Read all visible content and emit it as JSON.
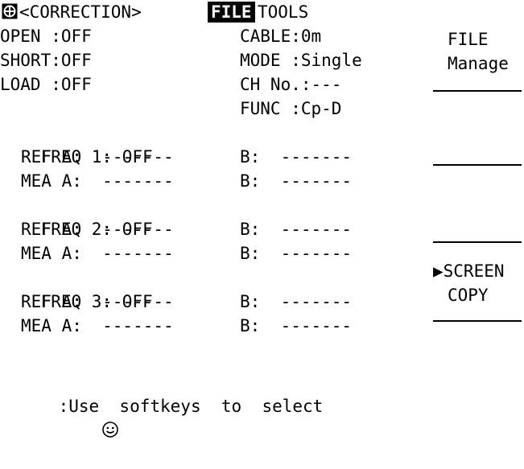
{
  "header": {
    "title": "<CORRECTION>",
    "menu_file": "FILE",
    "menu_tools": "TOOLS"
  },
  "left": {
    "open": "OPEN :OFF",
    "short": "SHORT:OFF",
    "load": "LOAD :OFF"
  },
  "right": {
    "cable": "CABLE:0m",
    "mode": "MODE :Single",
    "ch": "CH No.:---",
    "func": "FUNC :Cp-D"
  },
  "freq": [
    {
      "label": "FREQ 1:",
      "status": "OFF",
      "ref_a": "REF A:  -------",
      "ref_b": "B:  -------",
      "mea_a": "MEA A:  -------",
      "mea_b": "B:  -------"
    },
    {
      "label": "FREQ 2:",
      "status": "OFF",
      "ref_a": "REF A:  -------",
      "ref_b": "B:  -------",
      "mea_a": "MEA A:  -------",
      "mea_b": "B:  -------"
    },
    {
      "label": "FREQ 3:",
      "status": "OFF",
      "ref_a": "REF A:  -------",
      "ref_b": "B:  -------",
      "mea_a": "MEA A:  -------",
      "mea_b": "B:  -------"
    }
  ],
  "softkeys": {
    "k1_line1": "FILE",
    "k1_line2": "Manage",
    "k5_line1": "▶SCREEN",
    "k5_line2": "COPY"
  },
  "status": {
    "icon": "smiley-icon",
    "text": ":Use  softkeys  to  select"
  }
}
